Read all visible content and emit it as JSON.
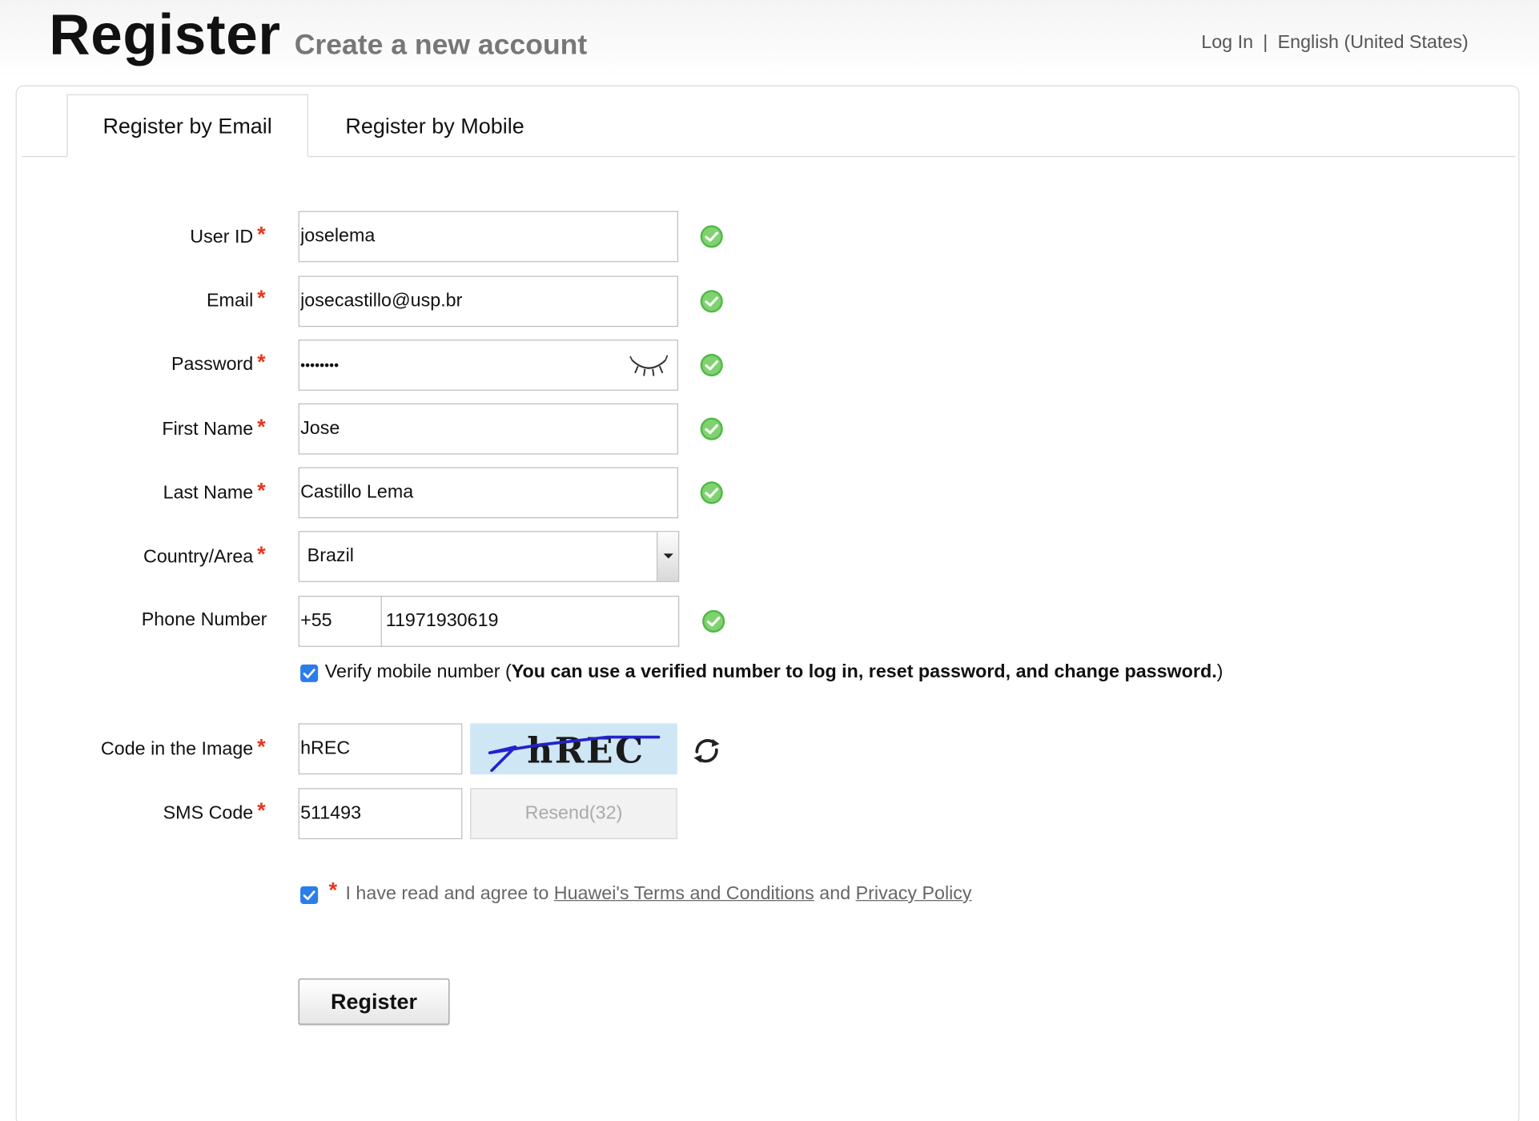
{
  "header": {
    "title": "Register",
    "subtitle": "Create a new account",
    "login_link": "Log In",
    "separator": "|",
    "language": "English (United States)"
  },
  "tabs": [
    {
      "label": "Register by Email",
      "active": true
    },
    {
      "label": "Register by Mobile",
      "active": false
    }
  ],
  "form": {
    "required_mark": "*",
    "user_id": {
      "label": "User ID",
      "value": "joselema",
      "valid": true
    },
    "email": {
      "label": "Email",
      "value": "josecastillo@usp.br",
      "valid": true
    },
    "password": {
      "label": "Password",
      "value": "••••••••",
      "valid": true,
      "toggle_icon": "eye-closed-icon"
    },
    "first_name": {
      "label": "First Name",
      "value": "Jose",
      "valid": true
    },
    "last_name": {
      "label": "Last Name",
      "value": "Castillo Lema",
      "valid": true
    },
    "country": {
      "label": "Country/Area",
      "value": "Brazil"
    },
    "phone": {
      "label": "Phone Number",
      "code": "+55",
      "number": "11971930619",
      "valid": true
    },
    "verify_mobile": {
      "checked": true,
      "text": "Verify mobile number (",
      "bold_text": "You can use a verified number to log in, reset password, and change password.",
      "close": ")"
    },
    "captcha": {
      "label": "Code in the Image",
      "value": "hREC",
      "image_text": "hREC",
      "refresh_icon": "refresh-icon"
    },
    "sms": {
      "label": "SMS Code",
      "value": "511493",
      "resend_label": "Resend(32)"
    },
    "agree": {
      "checked": true,
      "prefix": "I have read and agree to",
      "terms_link": "Huawei's Terms and Conditions",
      "and": "and",
      "privacy_link": "Privacy Policy"
    },
    "submit_label": "Register"
  },
  "colors": {
    "required": "#e8341c",
    "valid": "#4caf3e",
    "checkbox": "#2b7de9",
    "captcha_bg": "#cfe6f5"
  }
}
